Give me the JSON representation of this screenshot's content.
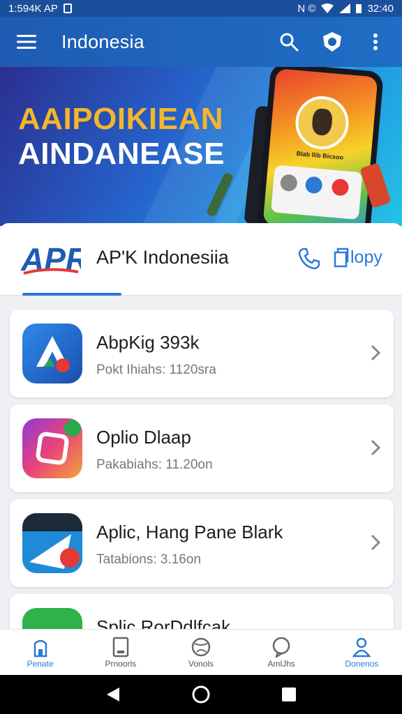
{
  "status_bar": {
    "left_text": "1:594K  AP",
    "right_text": "N  ©",
    "time": "32:40"
  },
  "app_bar": {
    "title": "Indonesia",
    "icons": [
      "menu-icon",
      "search-icon",
      "shield-icon",
      "more-vert-icon"
    ]
  },
  "banner": {
    "line1": "AAIPOIKIEAN",
    "line2": "AINDANEASE",
    "phone_caption": "Blab llib Bicsoo",
    "colors": {
      "line1": "#f4b62a",
      "line2": "#ffffff"
    }
  },
  "header": {
    "logo_text": "APR",
    "site_name": "AP'K Indonesiia",
    "copy_label": "lopy",
    "accent": "#2b7ad6"
  },
  "apps": [
    {
      "title": "AbpKig 393k",
      "subtitle": "Pokt Ihiahs: 1120sra"
    },
    {
      "title": "Oplio Dlaap",
      "subtitle": "Pakabiahs: 11.20on"
    },
    {
      "title": "Aplic, Hang Pane Blark",
      "subtitle": "Tatabions: 3.16on"
    },
    {
      "title": "Splic RorDdlfcak",
      "subtitle": ""
    }
  ],
  "bottom_nav": [
    {
      "label": "Penate",
      "icon": "home-icon",
      "active": true
    },
    {
      "label": "Prnoorls",
      "icon": "tablet-icon",
      "active": false
    },
    {
      "label": "Vonols",
      "icon": "globe-icon",
      "active": false
    },
    {
      "label": "AmlJhs",
      "icon": "chat-icon",
      "active": false
    },
    {
      "label": "Donenos",
      "icon": "person-icon",
      "active": true
    }
  ]
}
